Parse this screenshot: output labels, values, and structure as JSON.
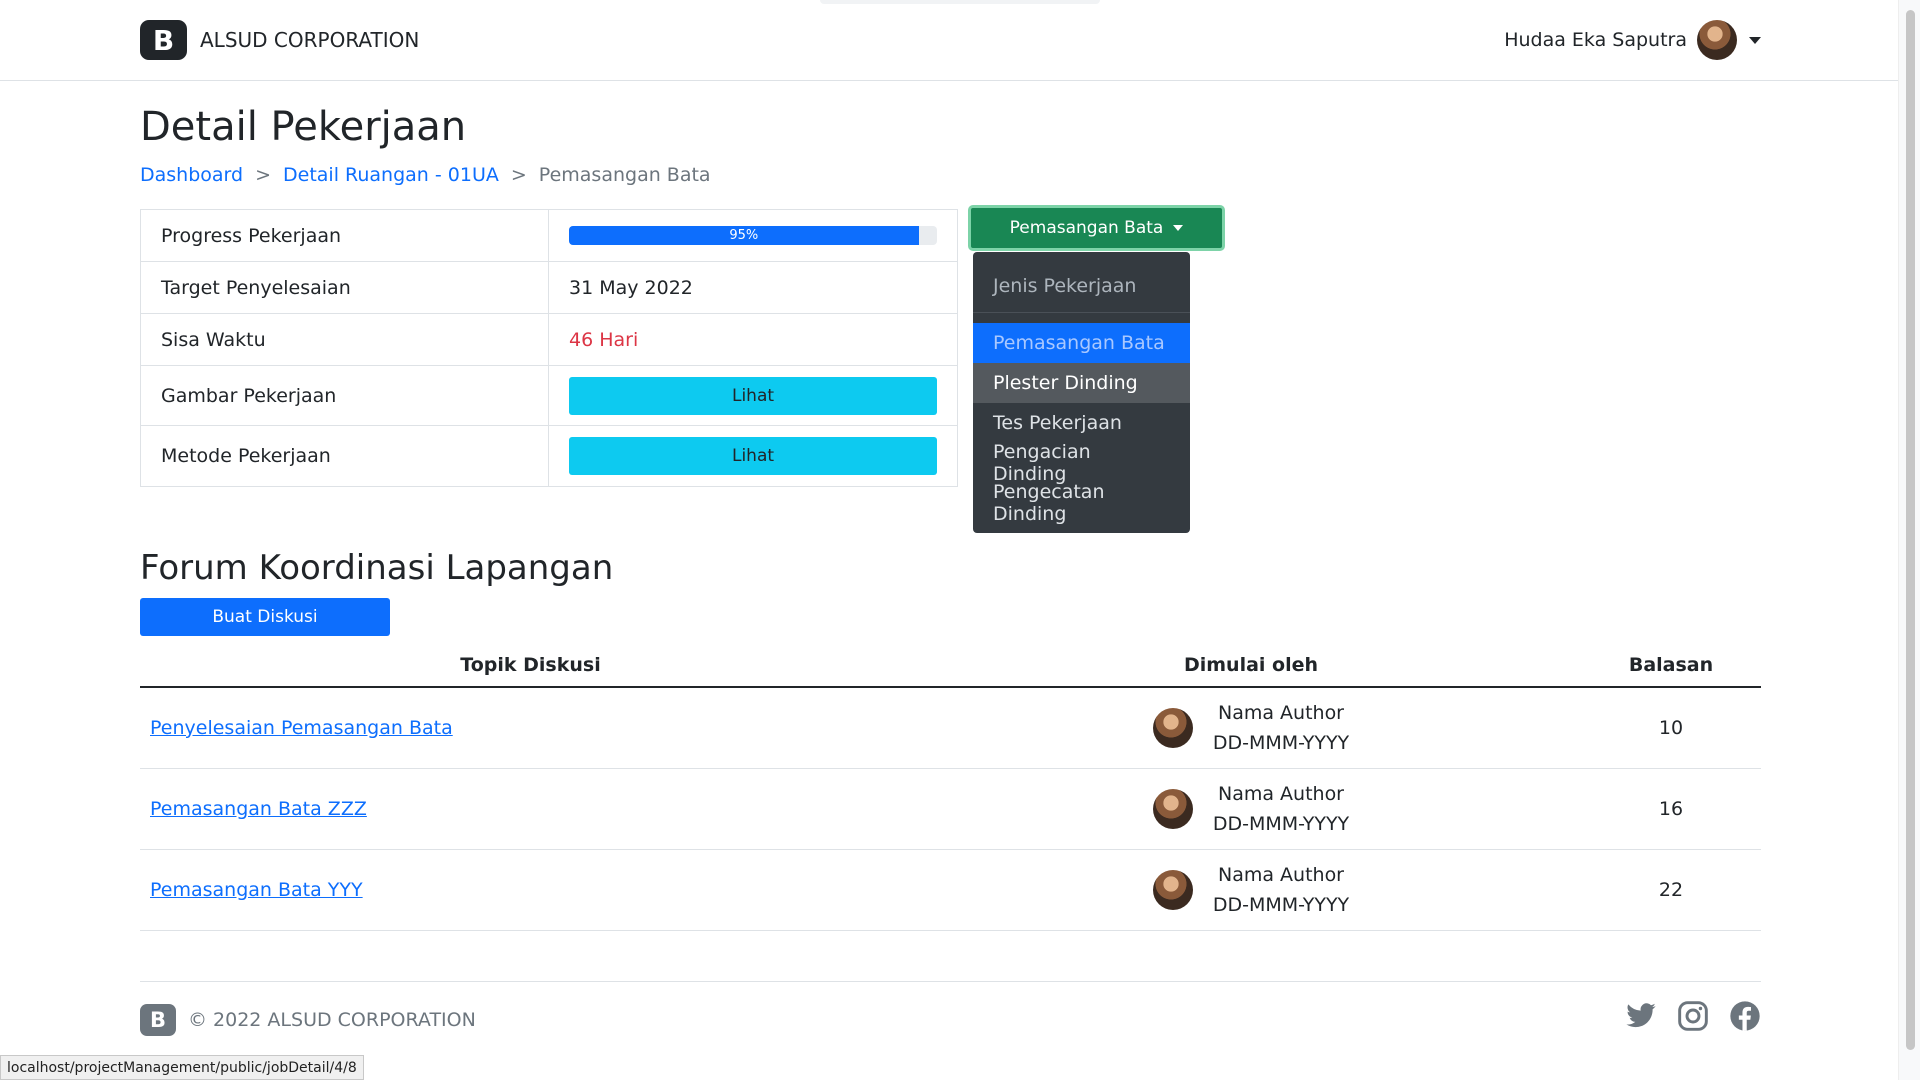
{
  "header": {
    "brand_letter": "B",
    "brand_name": "ALSUD CORPORATION",
    "user_name": "Hudaa Eka Saputra"
  },
  "page": {
    "title": "Detail Pekerjaan"
  },
  "breadcrumb": {
    "items": [
      "Dashboard",
      "Detail Ruangan - 01UA",
      "Pemasangan Bata"
    ],
    "separator": ">"
  },
  "info": {
    "progress_label": "Progress Pekerjaan",
    "progress_value": 95,
    "progress_text": "95%",
    "target_label": "Target Penyelesaian",
    "target_value": "31 May 2022",
    "remaining_label": "Sisa Waktu",
    "remaining_value": "46 Hari",
    "image_label": "Gambar Pekerjaan",
    "image_button": "Lihat",
    "method_label": "Metode Pekerjaan",
    "method_button": "Lihat"
  },
  "dropdown": {
    "toggle_label": "Pemasangan Bata",
    "header": "Jenis Pekerjaan",
    "items": [
      "Pemasangan Bata",
      "Plester Dinding",
      "Tes Pekerjaan",
      "Pengacian Dinding",
      "Pengecatan Dinding"
    ],
    "active_item": "Pemasangan Bata",
    "hovered_item": "Plester Dinding"
  },
  "forum": {
    "title": "Forum Koordinasi Lapangan",
    "create_button": "Buat Diskusi",
    "columns": [
      "Topik Diskusi",
      "Dimulai oleh",
      "Balasan"
    ],
    "rows": [
      {
        "topic": "Penyelesaian Pemasangan Bata",
        "author": "Nama Author",
        "date": "DD-MMM-YYYY",
        "replies": "10"
      },
      {
        "topic": "Pemasangan Bata ZZZ",
        "author": "Nama Author",
        "date": "DD-MMM-YYYY",
        "replies": "16"
      },
      {
        "topic": "Pemasangan Bata YYY",
        "author": "Nama Author",
        "date": "DD-MMM-YYYY",
        "replies": "22"
      }
    ]
  },
  "footer": {
    "brand_letter": "B",
    "copyright": "© 2022 ALSUD CORPORATION",
    "social_icons": [
      "twitter-icon",
      "instagram-icon",
      "facebook-icon"
    ]
  },
  "status_bar": {
    "url": "localhost/projectManagement/public/jobDetail/4/8"
  },
  "colors": {
    "primary": "#0d6efd",
    "success": "#198754",
    "info": "#0dcaf0",
    "danger": "#dc3545",
    "dark": "#343a40"
  }
}
